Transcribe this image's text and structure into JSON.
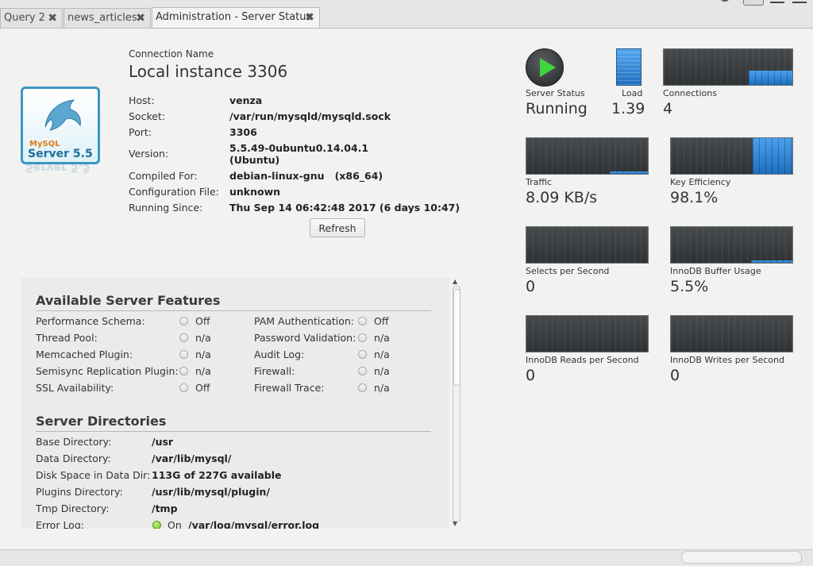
{
  "tabs": [
    {
      "label": "Query 2"
    },
    {
      "label": "news_articles"
    },
    {
      "label": "Administration - Server Status"
    }
  ],
  "connection": {
    "label": "Connection Name",
    "name": "Local instance 3306",
    "logo_text_top": "MySQL",
    "logo_text_bottom": "Server 5.5",
    "fields": [
      {
        "label": "Host:",
        "value": "venza"
      },
      {
        "label": "Socket:",
        "value": "/var/run/mysqld/mysqld.sock"
      },
      {
        "label": "Port:",
        "value": "3306"
      },
      {
        "label": "Version:",
        "value": "5.5.49-0ubuntu0.14.04.1",
        "value2": "(Ubuntu)"
      },
      {
        "label": "Compiled For:",
        "value": "debian-linux-gnu   (x86_64)"
      },
      {
        "label": "Configuration File:",
        "value": "unknown"
      },
      {
        "label": "Running Since:",
        "value": "Thu Sep 14 06:42:48 2017 (6 days 10:47)"
      }
    ],
    "refresh_label": "Refresh"
  },
  "features": {
    "title": "Available Server Features",
    "left": [
      {
        "label": "Performance Schema:",
        "value": "Off"
      },
      {
        "label": "Thread Pool:",
        "value": "n/a"
      },
      {
        "label": "Memcached Plugin:",
        "value": "n/a"
      },
      {
        "label": "Semisync Replication Plugin:",
        "value": "n/a"
      },
      {
        "label": "SSL Availability:",
        "value": "Off"
      }
    ],
    "right": [
      {
        "label": "PAM Authentication:",
        "value": "Off"
      },
      {
        "label": "Password Validation:",
        "value": "n/a"
      },
      {
        "label": "Audit Log:",
        "value": "n/a"
      },
      {
        "label": "Firewall:",
        "value": "n/a"
      },
      {
        "label": "Firewall Trace:",
        "value": "n/a"
      }
    ]
  },
  "directories": {
    "title": "Server Directories",
    "items": [
      {
        "label": "Base Directory:",
        "value": "/usr"
      },
      {
        "label": "Data Directory:",
        "value": "/var/lib/mysql/"
      },
      {
        "label": "Disk Space in Data Dir:",
        "value": "113G of 227G available"
      },
      {
        "label": "Plugins Directory:",
        "value": "/usr/lib/mysql/plugin/"
      },
      {
        "label": "Tmp Directory:",
        "value": "/tmp"
      },
      {
        "label": "Error Log:",
        "status": "On",
        "value": "/var/log/mysql/error.log"
      }
    ]
  },
  "status": {
    "server_status": {
      "label": "Server Status",
      "value": "Running",
      "icon": "play-icon",
      "color": "#3fd63f"
    },
    "load": {
      "label": "Load",
      "value": "1.39"
    },
    "connections": {
      "label": "Connections",
      "value": "4"
    },
    "traffic": {
      "label": "Traffic",
      "value": "8.09 KB/s"
    },
    "key_efficiency": {
      "label": "Key Efficiency",
      "value": "98.1%"
    },
    "selects": {
      "label": "Selects per Second",
      "value": "0"
    },
    "innodb_buffer": {
      "label": "InnoDB Buffer Usage",
      "value": "5.5%"
    },
    "innodb_reads": {
      "label": "InnoDB Reads per Second",
      "value": "0"
    },
    "innodb_writes": {
      "label": "InnoDB Writes per Second",
      "value": "0"
    },
    "accent_color": "#2f86d6"
  }
}
